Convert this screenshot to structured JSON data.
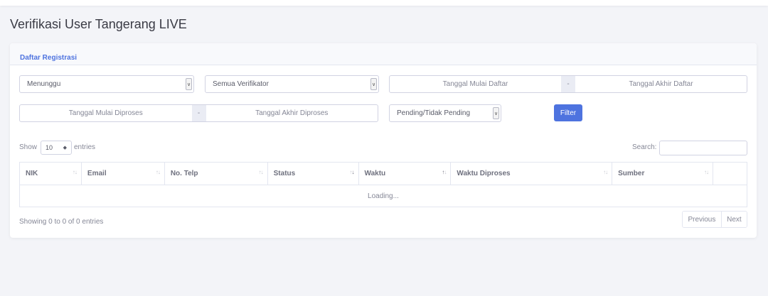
{
  "page": {
    "title": "Verifikasi User Tangerang LIVE"
  },
  "card": {
    "header": "Daftar Registrasi"
  },
  "filters": {
    "status_select": "Menunggu",
    "verifikator_select": "Semua Verifikator",
    "daftar_start_placeholder": "Tanggal Mulai Daftar",
    "daftar_sep": "-",
    "daftar_end_placeholder": "Tanggal Akhir Daftar",
    "proses_start_placeholder": "Tanggal Mulai Diproses",
    "proses_sep": "-",
    "proses_end_placeholder": "Tanggal Akhir Diproses",
    "pending_select": "Pending/Tidak Pending",
    "filter_button": "Filter",
    "accent_color": "#4e73df"
  },
  "table_controls": {
    "show_label": "Show",
    "entries_value": "10",
    "entries_label": "entries",
    "search_label": "Search:"
  },
  "table": {
    "columns": [
      "NIK",
      "Email",
      "No. Telp",
      "Status",
      "Waktu",
      "Waktu Diproses",
      "Sumber"
    ],
    "loading_text": "Loading..."
  },
  "footer": {
    "info": "Showing 0 to 0 of 0 entries",
    "previous": "Previous",
    "next": "Next"
  }
}
